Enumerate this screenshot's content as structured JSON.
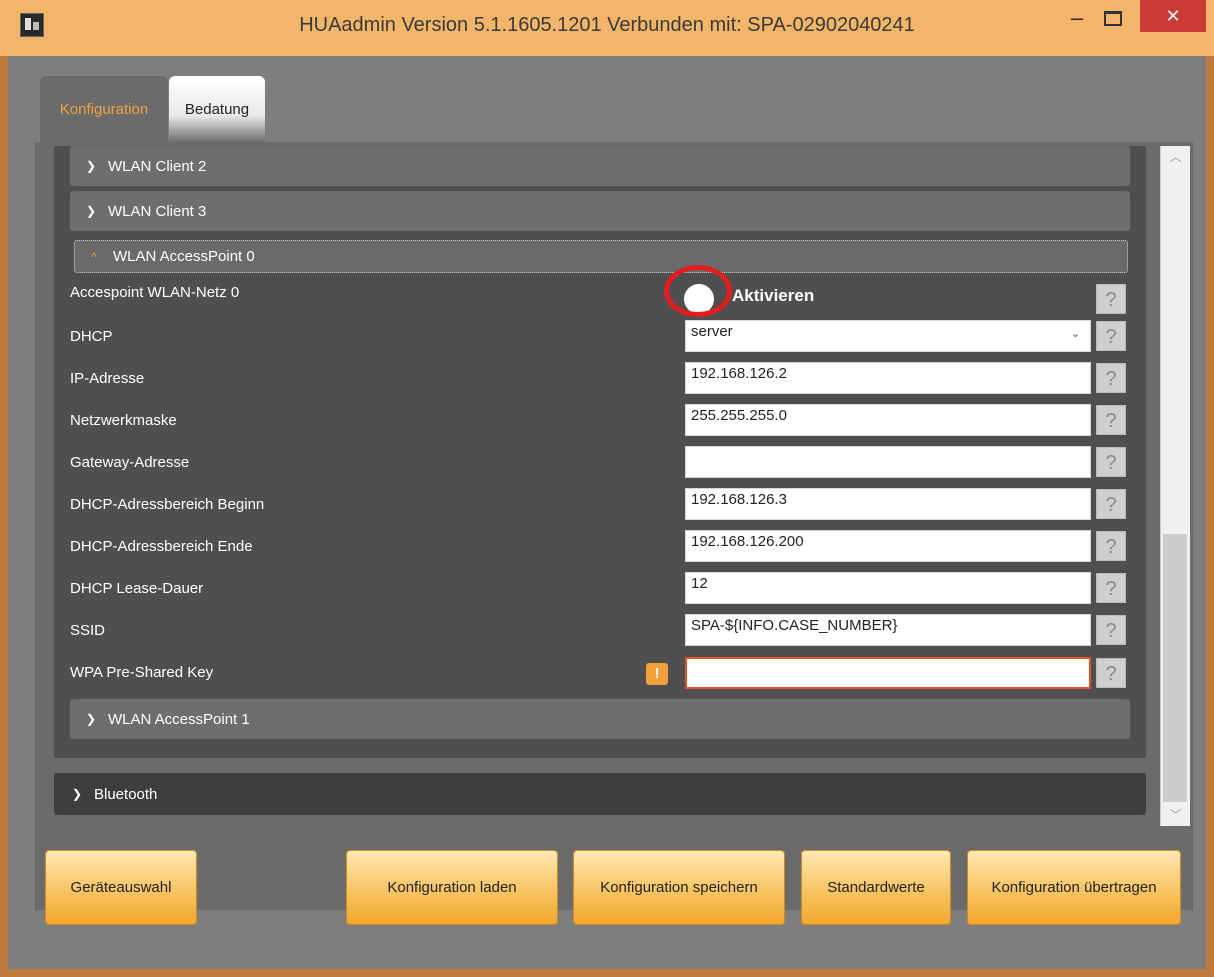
{
  "window": {
    "title": "HUAadmin Version 5.1.1605.1201 Verbunden mit: SPA-02902040241",
    "minimize": "–",
    "close": "✕"
  },
  "tabs": [
    {
      "label": "Konfiguration",
      "active": true
    },
    {
      "label": "Bedatung",
      "active": false
    }
  ],
  "sections": {
    "client2": "WLAN Client 2",
    "client3": "WLAN Client 3",
    "ap0": "WLAN AccessPoint 0",
    "ap1": "WLAN AccessPoint 1",
    "bluetooth": "Bluetooth"
  },
  "ap0": {
    "accesspoint_label": "Accespoint WLAN-Netz 0",
    "activate_label": "Aktivieren",
    "dhcp_label": "DHCP",
    "dhcp_value": "server",
    "ip_label": "IP-Adresse",
    "ip_value": "192.168.126.2",
    "mask_label": "Netzwerkmaske",
    "mask_value": "255.255.255.0",
    "gateway_label": "Gateway-Adresse",
    "gateway_value": "",
    "range_start_label": "DHCP-Adressbereich Beginn",
    "range_start_value": "192.168.126.3",
    "range_end_label": "DHCP-Adressbereich Ende",
    "range_end_value": "192.168.126.200",
    "lease_label": "DHCP Lease-Dauer",
    "lease_value": "12",
    "ssid_label": "SSID",
    "ssid_value": "SPA-${INFO.CASE_NUMBER}",
    "wpa_label": "WPA Pre-Shared Key",
    "wpa_value": "",
    "warning_glyph": "!"
  },
  "help_glyph": "?",
  "buttons": {
    "device_select": "Geräteauswahl",
    "load": "Konfiguration laden",
    "save": "Konfiguration speichern",
    "defaults": "Standardwerte",
    "transfer": "Konfiguration übertragen"
  },
  "colors": {
    "titlebar": "#f2b56a",
    "accent": "#f2a23c",
    "close": "#cc3a35",
    "annotation": "#e31d1d"
  }
}
